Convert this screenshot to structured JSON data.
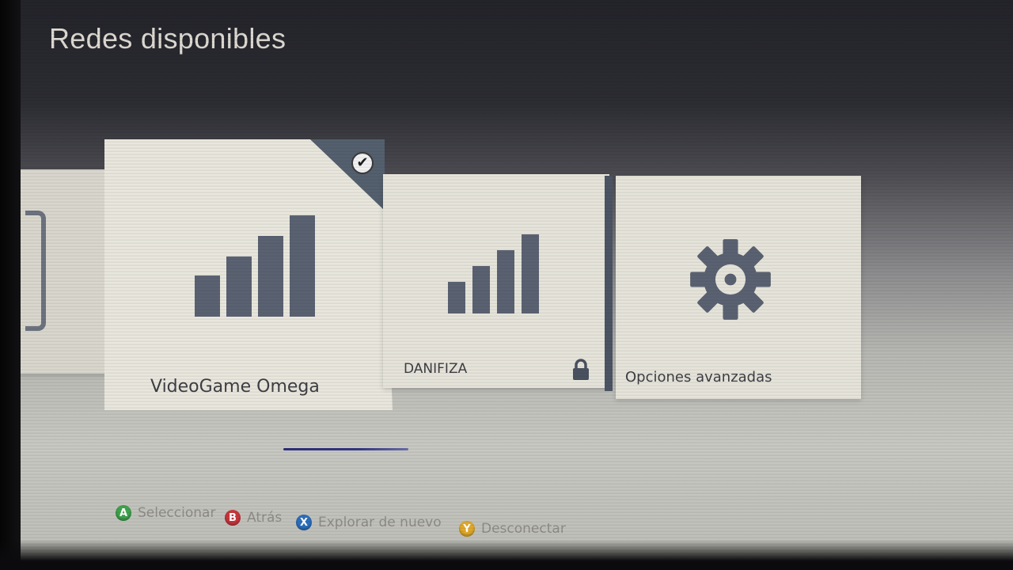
{
  "header": {
    "title": "Redes disponibles"
  },
  "networks": [
    {
      "name": "VideoGame Omega",
      "connected": true,
      "signal_bars": 4,
      "secured": false
    },
    {
      "name": "DANIFIZA",
      "connected": false,
      "signal_bars": 4,
      "secured": true
    }
  ],
  "advanced": {
    "label": "Opciones avanzadas",
    "icon": "gear-icon"
  },
  "footer": {
    "hints": [
      {
        "button": "A",
        "label": "Seleccionar",
        "color": "#3fa34d"
      },
      {
        "button": "B",
        "label": "Atrás",
        "color": "#c9363c"
      },
      {
        "button": "X",
        "label": "Explorar de nuevo",
        "color": "#2d6fbe"
      },
      {
        "button": "Y",
        "label": "Desconectar",
        "color": "#e0a92a"
      }
    ]
  },
  "icons": {
    "connected": "checkmark-circle-icon",
    "secured": "lock-icon",
    "signal": "signal-strength-icon"
  }
}
